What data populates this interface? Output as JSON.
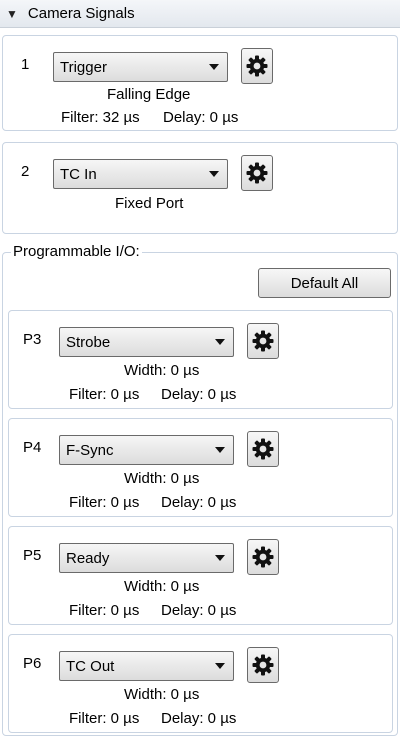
{
  "header": {
    "title": "Camera Signals"
  },
  "signals": [
    {
      "number": "1",
      "selected": "Trigger",
      "line1": "Falling Edge",
      "filter": "Filter: 32 µs",
      "delay": "Delay: 0 µs"
    },
    {
      "number": "2",
      "selected": "TC In",
      "line1": "Fixed Port"
    }
  ],
  "programmable": {
    "label": "Programmable I/O:",
    "default_all_label": "Default All",
    "ports": [
      {
        "number": "P3",
        "selected": "Strobe",
        "width": "Width: 0 µs",
        "filter": "Filter: 0 µs",
        "delay": "Delay: 0 µs"
      },
      {
        "number": "P4",
        "selected": "F-Sync",
        "width": "Width: 0 µs",
        "filter": "Filter: 0 µs",
        "delay": "Delay: 0 µs"
      },
      {
        "number": "P5",
        "selected": "Ready",
        "width": "Width: 0 µs",
        "filter": "Filter: 0 µs",
        "delay": "Delay: 0 µs"
      },
      {
        "number": "P6",
        "selected": "TC Out",
        "width": "Width: 0 µs",
        "filter": "Filter: 0 µs",
        "delay": "Delay: 0 µs"
      }
    ]
  }
}
